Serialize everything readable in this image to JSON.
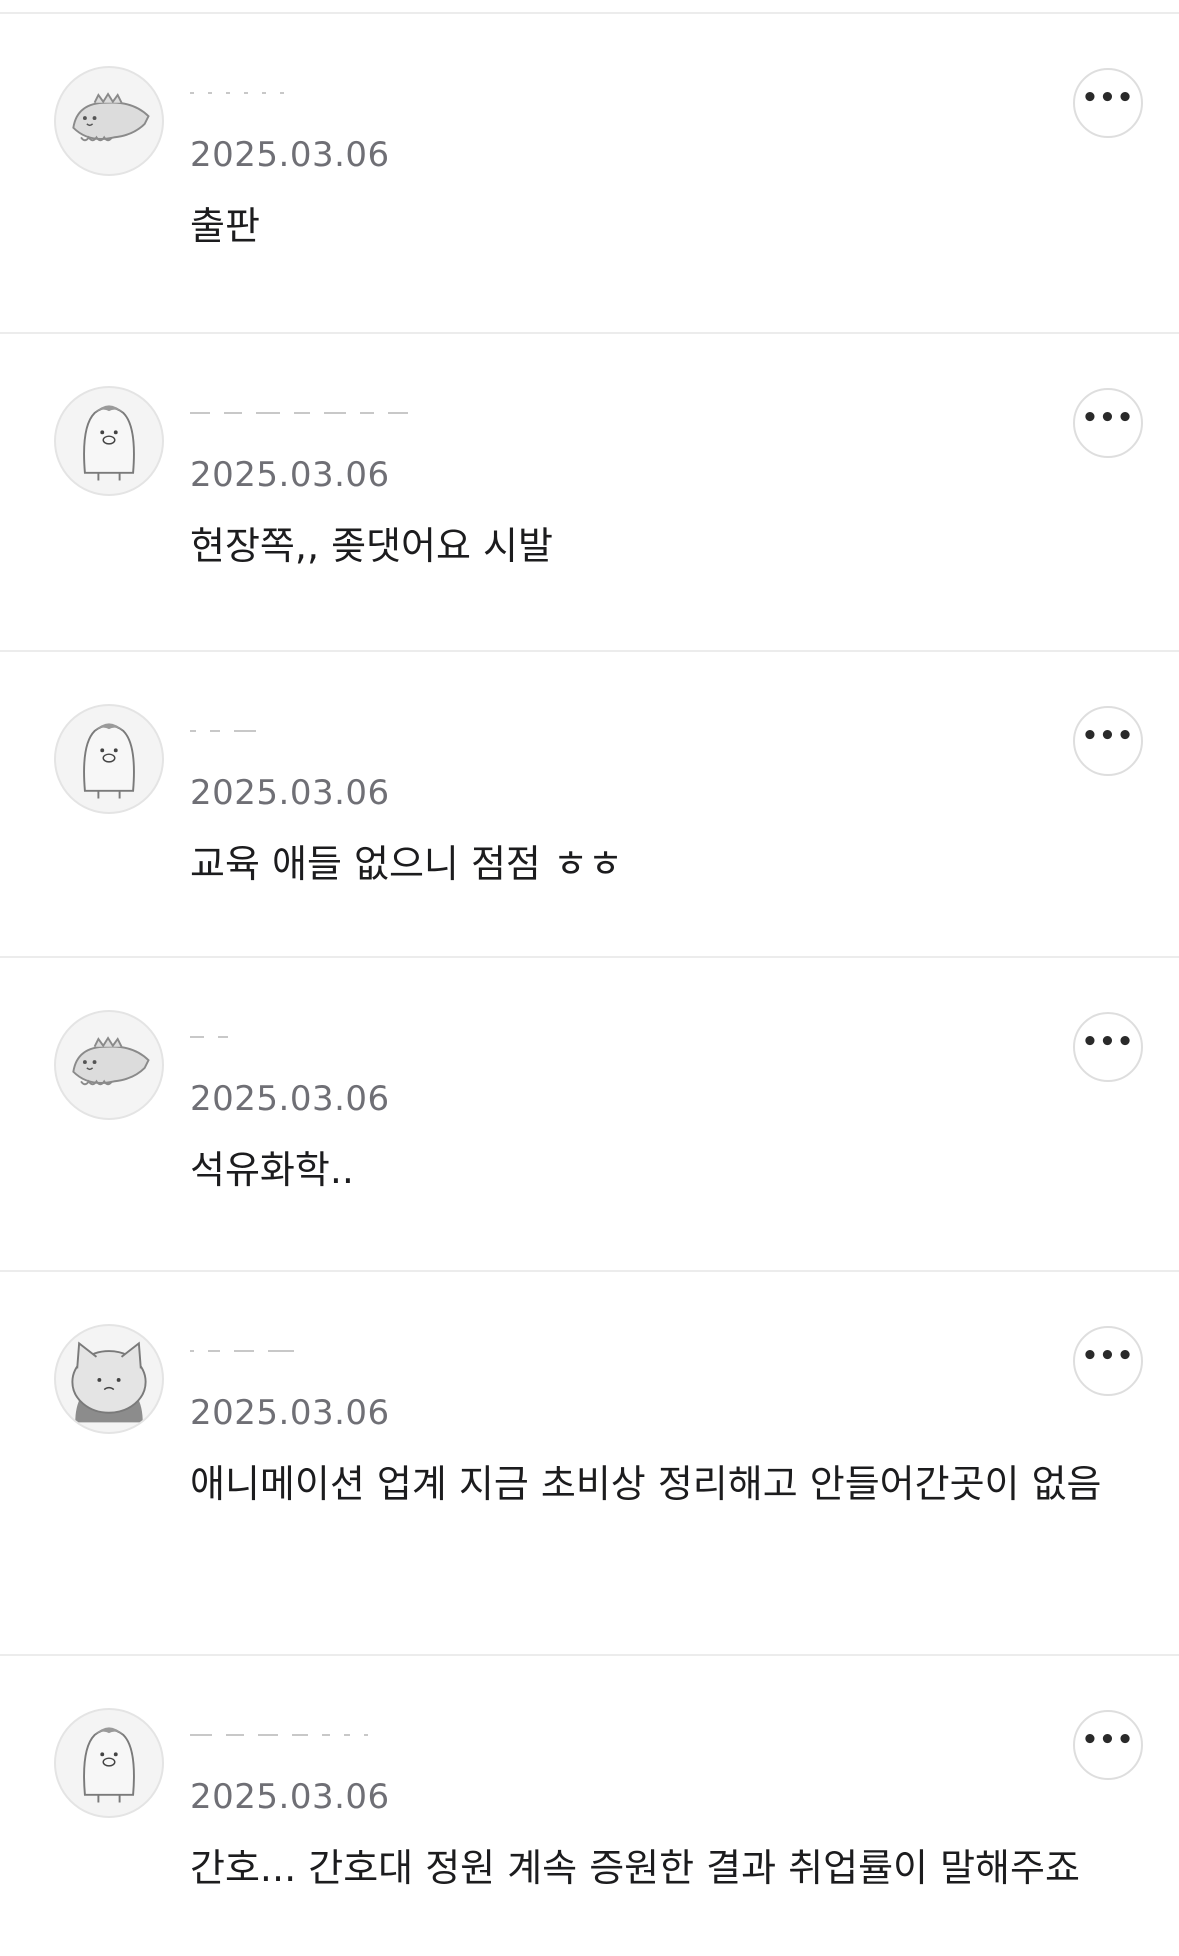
{
  "comments": [
    {
      "avatar": "dinosaur-avatar-icon",
      "date": "2025.03.06",
      "text": "출판"
    },
    {
      "avatar": "penguin-avatar-icon",
      "date": "2025.03.06",
      "text": "현장쪽,, 좆댓어요 시발"
    },
    {
      "avatar": "penguin-avatar-icon",
      "date": "2025.03.06",
      "text": "교육 애들 없으니 점점 ㅎㅎ"
    },
    {
      "avatar": "dinosaur-avatar-icon",
      "date": "2025.03.06",
      "text": "석유화학.."
    },
    {
      "avatar": "cat-avatar-icon",
      "date": "2025.03.06",
      "text": "애니메이션 업계 지금 초비상 정리해고 안들어간곳이 없음"
    },
    {
      "avatar": "penguin-avatar-icon",
      "date": "2025.03.06",
      "text": "간호... 간호대 정원 계속 증원한 결과 취업률이 말해주죠"
    }
  ],
  "more_button": {
    "label": "•••",
    "icon": "more-options-icon"
  },
  "colors": {
    "divider": "#ececec",
    "date": "#6f6f75",
    "text": "#1c1c1e",
    "avatar_bg": "#f4f4f4"
  }
}
